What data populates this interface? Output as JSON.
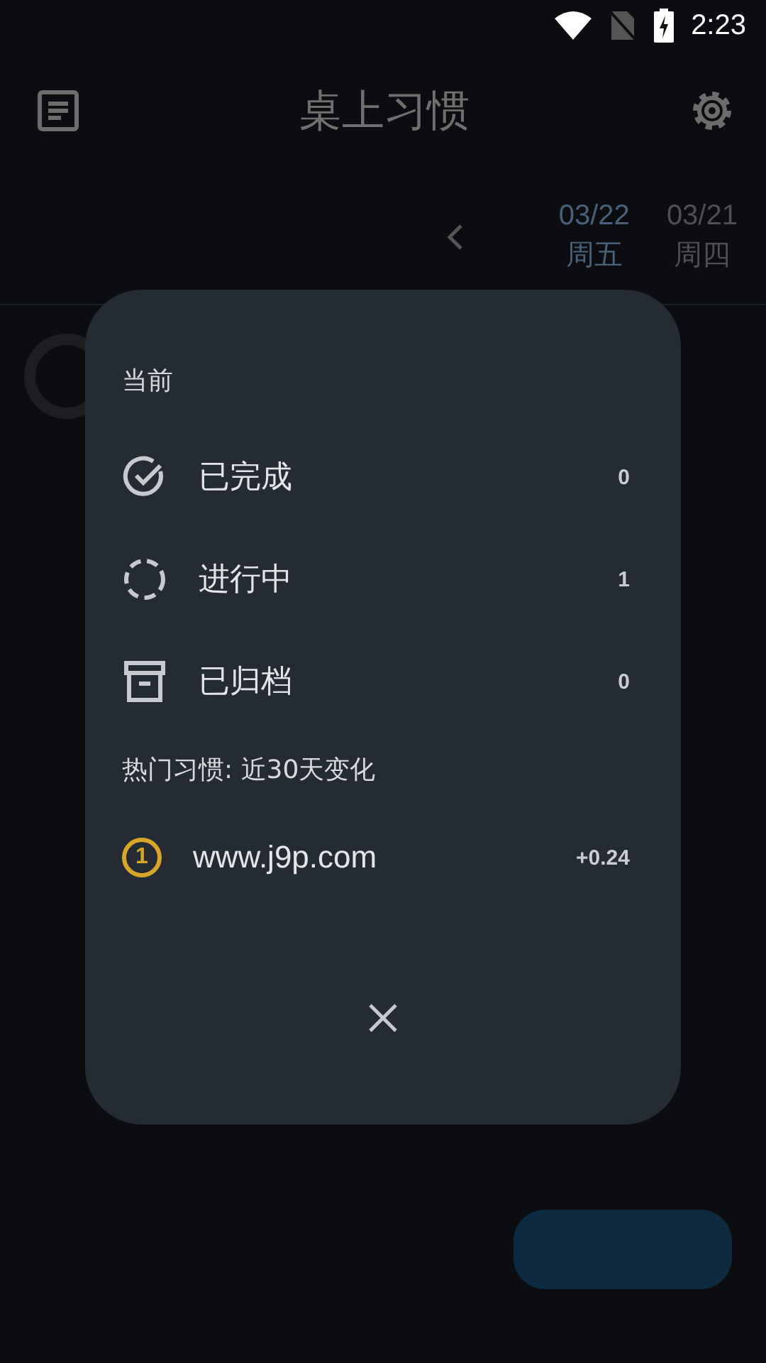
{
  "status_bar": {
    "time": "2:23"
  },
  "app_bar": {
    "title": "桌上习惯"
  },
  "dates": [
    {
      "date": "03/22",
      "weekday": "周五",
      "selected": true
    },
    {
      "date": "03/21",
      "weekday": "周四",
      "selected": false
    }
  ],
  "dialog": {
    "section_title": "当前",
    "stats": [
      {
        "kind": "done",
        "label": "已完成",
        "count": "0"
      },
      {
        "kind": "progress",
        "label": "进行中",
        "count": "1"
      },
      {
        "kind": "archived",
        "label": "已归档",
        "count": "0"
      }
    ],
    "trending_title": "热门习惯: 近30天变化",
    "trending": [
      {
        "rank": "1",
        "name": "www.j9p.com",
        "change": "+0.24",
        "color": "#d8a62a"
      }
    ]
  }
}
